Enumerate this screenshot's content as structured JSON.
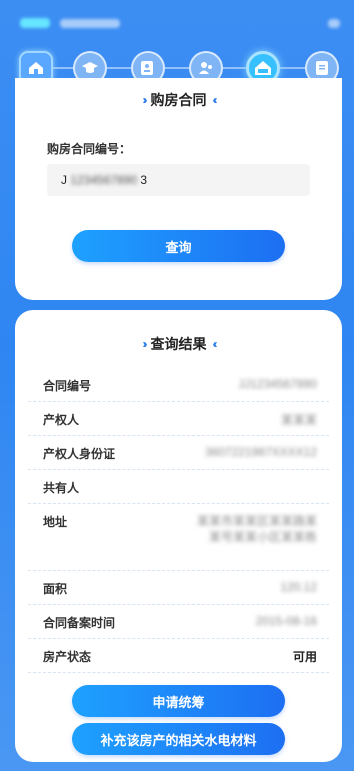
{
  "header": {
    "status_text": "",
    "right_text": ""
  },
  "steps": [
    {
      "icon": "home-icon",
      "state": "active-home"
    },
    {
      "icon": "graduation-cap-icon",
      "state": "idle"
    },
    {
      "icon": "id-card-icon",
      "state": "idle"
    },
    {
      "icon": "user-group-icon",
      "state": "idle"
    },
    {
      "icon": "house-contract-icon",
      "state": "active"
    },
    {
      "icon": "document-icon",
      "state": "idle"
    }
  ],
  "contract_section": {
    "title": "购房合同",
    "field_label": "购房合同编号：",
    "field_prefix": "J",
    "field_value": "3",
    "query_button": "查询"
  },
  "result_section": {
    "title": "查询结果",
    "rows": [
      {
        "label": "合同编号",
        "value": ""
      },
      {
        "label": "产权人",
        "value": ""
      },
      {
        "label": "产权人身份证",
        "value": ""
      },
      {
        "label": "共有人",
        "value": ""
      },
      {
        "label": "地址",
        "value": ""
      },
      {
        "label": "面积",
        "value": ""
      },
      {
        "label": "合同备案时间",
        "value": ""
      },
      {
        "label": "房产状态",
        "value": "可用"
      }
    ],
    "apply_button": "申请统筹",
    "supplement_button": "补充该房产的相关水电材料"
  },
  "colors": {
    "background": "#3d8ef3",
    "accent": "#1d6ff2",
    "active_step": "#36c0ff"
  }
}
